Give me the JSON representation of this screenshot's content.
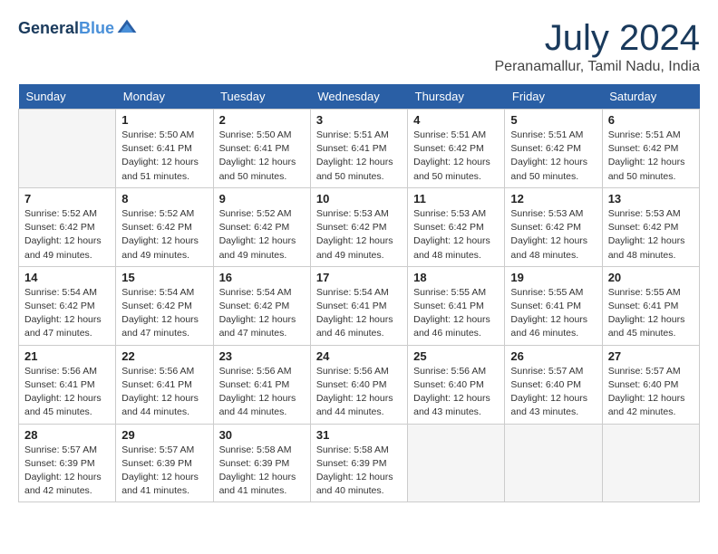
{
  "logo": {
    "line1": "General",
    "line2": "Blue"
  },
  "title": "July 2024",
  "subtitle": "Peranamallur, Tamil Nadu, India",
  "weekdays": [
    "Sunday",
    "Monday",
    "Tuesday",
    "Wednesday",
    "Thursday",
    "Friday",
    "Saturday"
  ],
  "weeks": [
    [
      {
        "day": "",
        "info": ""
      },
      {
        "day": "1",
        "info": "Sunrise: 5:50 AM\nSunset: 6:41 PM\nDaylight: 12 hours\nand 51 minutes."
      },
      {
        "day": "2",
        "info": "Sunrise: 5:50 AM\nSunset: 6:41 PM\nDaylight: 12 hours\nand 50 minutes."
      },
      {
        "day": "3",
        "info": "Sunrise: 5:51 AM\nSunset: 6:41 PM\nDaylight: 12 hours\nand 50 minutes."
      },
      {
        "day": "4",
        "info": "Sunrise: 5:51 AM\nSunset: 6:42 PM\nDaylight: 12 hours\nand 50 minutes."
      },
      {
        "day": "5",
        "info": "Sunrise: 5:51 AM\nSunset: 6:42 PM\nDaylight: 12 hours\nand 50 minutes."
      },
      {
        "day": "6",
        "info": "Sunrise: 5:51 AM\nSunset: 6:42 PM\nDaylight: 12 hours\nand 50 minutes."
      }
    ],
    [
      {
        "day": "7",
        "info": "Sunrise: 5:52 AM\nSunset: 6:42 PM\nDaylight: 12 hours\nand 49 minutes."
      },
      {
        "day": "8",
        "info": "Sunrise: 5:52 AM\nSunset: 6:42 PM\nDaylight: 12 hours\nand 49 minutes."
      },
      {
        "day": "9",
        "info": "Sunrise: 5:52 AM\nSunset: 6:42 PM\nDaylight: 12 hours\nand 49 minutes."
      },
      {
        "day": "10",
        "info": "Sunrise: 5:53 AM\nSunset: 6:42 PM\nDaylight: 12 hours\nand 49 minutes."
      },
      {
        "day": "11",
        "info": "Sunrise: 5:53 AM\nSunset: 6:42 PM\nDaylight: 12 hours\nand 48 minutes."
      },
      {
        "day": "12",
        "info": "Sunrise: 5:53 AM\nSunset: 6:42 PM\nDaylight: 12 hours\nand 48 minutes."
      },
      {
        "day": "13",
        "info": "Sunrise: 5:53 AM\nSunset: 6:42 PM\nDaylight: 12 hours\nand 48 minutes."
      }
    ],
    [
      {
        "day": "14",
        "info": "Sunrise: 5:54 AM\nSunset: 6:42 PM\nDaylight: 12 hours\nand 47 minutes."
      },
      {
        "day": "15",
        "info": "Sunrise: 5:54 AM\nSunset: 6:42 PM\nDaylight: 12 hours\nand 47 minutes."
      },
      {
        "day": "16",
        "info": "Sunrise: 5:54 AM\nSunset: 6:42 PM\nDaylight: 12 hours\nand 47 minutes."
      },
      {
        "day": "17",
        "info": "Sunrise: 5:54 AM\nSunset: 6:41 PM\nDaylight: 12 hours\nand 46 minutes."
      },
      {
        "day": "18",
        "info": "Sunrise: 5:55 AM\nSunset: 6:41 PM\nDaylight: 12 hours\nand 46 minutes."
      },
      {
        "day": "19",
        "info": "Sunrise: 5:55 AM\nSunset: 6:41 PM\nDaylight: 12 hours\nand 46 minutes."
      },
      {
        "day": "20",
        "info": "Sunrise: 5:55 AM\nSunset: 6:41 PM\nDaylight: 12 hours\nand 45 minutes."
      }
    ],
    [
      {
        "day": "21",
        "info": "Sunrise: 5:56 AM\nSunset: 6:41 PM\nDaylight: 12 hours\nand 45 minutes."
      },
      {
        "day": "22",
        "info": "Sunrise: 5:56 AM\nSunset: 6:41 PM\nDaylight: 12 hours\nand 44 minutes."
      },
      {
        "day": "23",
        "info": "Sunrise: 5:56 AM\nSunset: 6:41 PM\nDaylight: 12 hours\nand 44 minutes."
      },
      {
        "day": "24",
        "info": "Sunrise: 5:56 AM\nSunset: 6:40 PM\nDaylight: 12 hours\nand 44 minutes."
      },
      {
        "day": "25",
        "info": "Sunrise: 5:56 AM\nSunset: 6:40 PM\nDaylight: 12 hours\nand 43 minutes."
      },
      {
        "day": "26",
        "info": "Sunrise: 5:57 AM\nSunset: 6:40 PM\nDaylight: 12 hours\nand 43 minutes."
      },
      {
        "day": "27",
        "info": "Sunrise: 5:57 AM\nSunset: 6:40 PM\nDaylight: 12 hours\nand 42 minutes."
      }
    ],
    [
      {
        "day": "28",
        "info": "Sunrise: 5:57 AM\nSunset: 6:39 PM\nDaylight: 12 hours\nand 42 minutes."
      },
      {
        "day": "29",
        "info": "Sunrise: 5:57 AM\nSunset: 6:39 PM\nDaylight: 12 hours\nand 41 minutes."
      },
      {
        "day": "30",
        "info": "Sunrise: 5:58 AM\nSunset: 6:39 PM\nDaylight: 12 hours\nand 41 minutes."
      },
      {
        "day": "31",
        "info": "Sunrise: 5:58 AM\nSunset: 6:39 PM\nDaylight: 12 hours\nand 40 minutes."
      },
      {
        "day": "",
        "info": ""
      },
      {
        "day": "",
        "info": ""
      },
      {
        "day": "",
        "info": ""
      }
    ]
  ]
}
